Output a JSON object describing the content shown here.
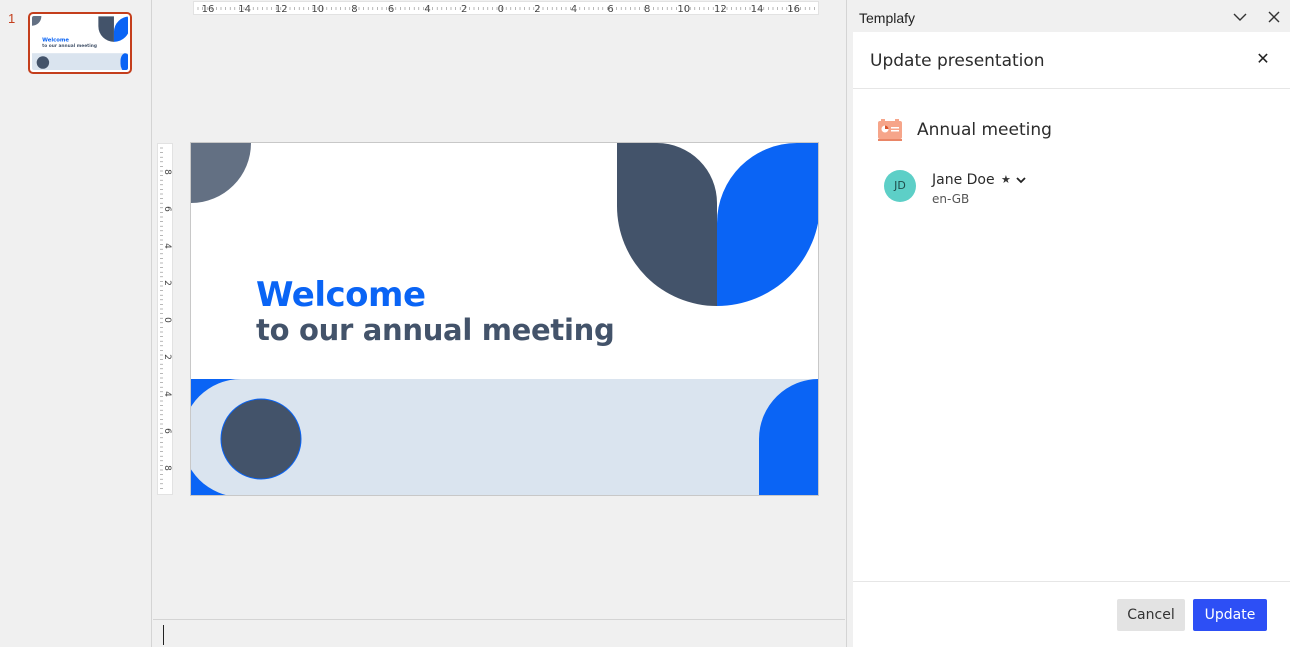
{
  "thumbnails": {
    "slide_number": "1",
    "thumb_title": "Welcome",
    "thumb_subtitle": "to our annual meeting"
  },
  "slide": {
    "title": "Welcome",
    "subtitle": "to our annual meeting",
    "colors": {
      "blue": "#0a64f5",
      "navy": "#43536a",
      "slate": "#637083",
      "light_band": "#dae4ef"
    }
  },
  "rulers": {
    "horizontal_labels": [
      "16",
      "14",
      "12",
      "10",
      "8",
      "6",
      "4",
      "2",
      "0",
      "2",
      "4",
      "6",
      "8",
      "10",
      "12",
      "14",
      "16"
    ],
    "vertical_labels": [
      "8",
      "6",
      "4",
      "2",
      "0",
      "2",
      "4",
      "6",
      "8"
    ]
  },
  "taskpane": {
    "app_title": "Templafy",
    "collapse_icon": "chevron-down-icon",
    "close_icon": "close-icon",
    "panel_title": "Update presentation",
    "panel_close": "✕",
    "document": {
      "icon": "powerpoint-file-icon",
      "name": "Annual meeting"
    },
    "user": {
      "initials": "JD",
      "name": "Jane Doe",
      "star": "★",
      "locale": "en-GB"
    },
    "buttons": {
      "cancel": "Cancel",
      "update": "Update"
    },
    "accent_color": "#2d4ff5"
  }
}
